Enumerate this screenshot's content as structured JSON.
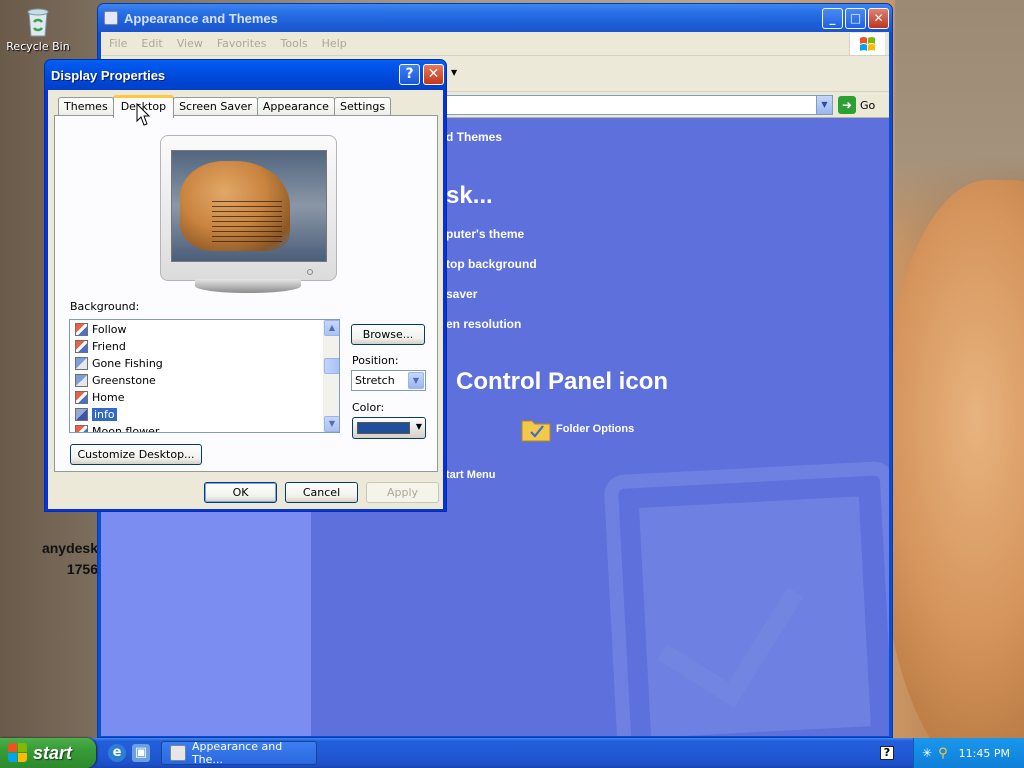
{
  "desktop": {
    "recycle_bin_label": "Recycle Bin",
    "anydesk_label": "anydesk",
    "anydesk_id": "1756"
  },
  "explorer": {
    "title": "Appearance and Themes",
    "menu": [
      "File",
      "Edit",
      "View",
      "Favorites",
      "Tools",
      "Help"
    ],
    "address_go_label": "Go",
    "header_text": "d Themes",
    "task_heading": "sk...",
    "tasks": [
      "puter's theme",
      "top background",
      "saver",
      "en resolution"
    ],
    "cp_heading": "Control Panel icon",
    "cp_items": [
      "Folder Options"
    ],
    "extra_link": "tart Menu"
  },
  "dialog": {
    "title": "Display Properties",
    "help_glyph": "?",
    "close_glyph": "✕",
    "tabs": [
      "Themes",
      "Desktop",
      "Screen Saver",
      "Appearance",
      "Settings"
    ],
    "active_tab": "Desktop",
    "background_label": "Background:",
    "background_items": [
      "Follow",
      "Friend",
      "Gone Fishing",
      "Greenstone",
      "Home",
      "info",
      "Moon flower"
    ],
    "selected_background": "info",
    "browse_label": "Browse...",
    "position_label": "Position:",
    "position_value": "Stretch",
    "color_label": "Color:",
    "color_value": "#1f4f9c",
    "customize_label": "Customize Desktop...",
    "ok_label": "OK",
    "cancel_label": "Cancel",
    "apply_label": "Apply"
  },
  "taskbar": {
    "start_label": "start",
    "task_button_label": "Appearance and The...",
    "help_glyph": "?",
    "clock": "11:45 PM"
  }
}
